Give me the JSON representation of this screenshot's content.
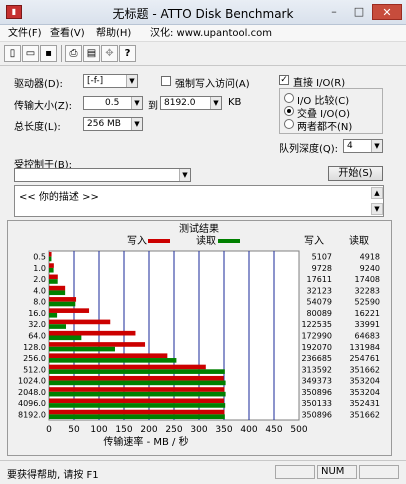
{
  "window": {
    "title": "无标题 - ATTO Disk Benchmark",
    "min": "–",
    "max": "□",
    "close": "✕"
  },
  "menu": [
    "文件(F)",
    "查看(V)",
    "帮助(H)",
    "汉化: www.upantool.com"
  ],
  "toolbar": {
    "icons": [
      "new-file-icon",
      "open-folder-icon",
      "save-icon",
      "print-icon",
      "print-preview-icon",
      "move-icon",
      "help-icon"
    ],
    "labels": [
      "▯",
      "▭",
      "▪",
      "⎙",
      "▤",
      "✥",
      "?"
    ]
  },
  "form": {
    "drive_label": "驱动器(D):",
    "drive_value": "[-f-]",
    "force_write_label": "强制写入访问(A)",
    "force_write_checked": false,
    "transfer_label": "传输大小(Z):",
    "transfer_from": "0.5",
    "transfer_to_label": "到",
    "transfer_to": "8192.0",
    "transfer_unit": "KB",
    "total_label": "总长度(L):",
    "total_value": "256 MB",
    "direct_io_label": "直接 I/O(R)",
    "direct_io_checked": true,
    "io_compare_label": "I/O 比较(C)",
    "overlap_io_label": "交叠 I/O(O)",
    "neither_label": "两者都不(N)",
    "selected_io": "overlap",
    "queue_depth_label": "队列深度(Q):",
    "queue_depth_value": "4",
    "controlled_by_label": "受控制于(B):",
    "controlled_by_value": "",
    "start_button": "开始(S)",
    "description": "<<  你的描述   >>"
  },
  "chart_data": {
    "type": "bar",
    "title": "测试结果",
    "xlabel": "传输速率 - MB / 秒",
    "ylabel": "",
    "xlim": [
      0,
      500
    ],
    "xticks": [
      "0",
      "50",
      "100",
      "150",
      "200",
      "250",
      "300",
      "350",
      "400",
      "450",
      "500"
    ],
    "orientation": "horizontal",
    "categories": [
      "0.5",
      "1.0",
      "2.0",
      "4.0",
      "8.0",
      "16.0",
      "32.0",
      "64.0",
      "128.0",
      "256.0",
      "512.0",
      "1024.0",
      "2048.0",
      "4096.0",
      "8192.0"
    ],
    "series": [
      {
        "name": "写入",
        "color": "#cc0000",
        "values": [
          5.1,
          9.7,
          17.6,
          32.3,
          54.1,
          80.1,
          122.5,
          172.9,
          192.1,
          236.7,
          313.6,
          349.4,
          350.9,
          350.1,
          350.9
        ]
      },
      {
        "name": "读取",
        "color": "#008000",
        "values": [
          4.9,
          9.2,
          17.4,
          32.3,
          52.6,
          16.2,
          34.0,
          64.7,
          131.98,
          254.8,
          351.7,
          353.2,
          353.2,
          352.4,
          351.7
        ]
      }
    ],
    "legend_position": "top",
    "table_headers": [
      "写入",
      "读取"
    ],
    "table_write": [
      "5107",
      "9728",
      "17611",
      "32123",
      "54079",
      "80089",
      "122535",
      "172990",
      "192070",
      "236685",
      "313592",
      "349373",
      "350896",
      "350133",
      "350896"
    ],
    "table_read": [
      "4918",
      "9240",
      "17408",
      "32283",
      "52590",
      "16221",
      "33991",
      "64683",
      "131984",
      "254761",
      "351662",
      "353204",
      "353204",
      "352431",
      "351662"
    ]
  },
  "status": {
    "help_text": "要获得帮助, 请按 F1",
    "num": "NUM"
  }
}
